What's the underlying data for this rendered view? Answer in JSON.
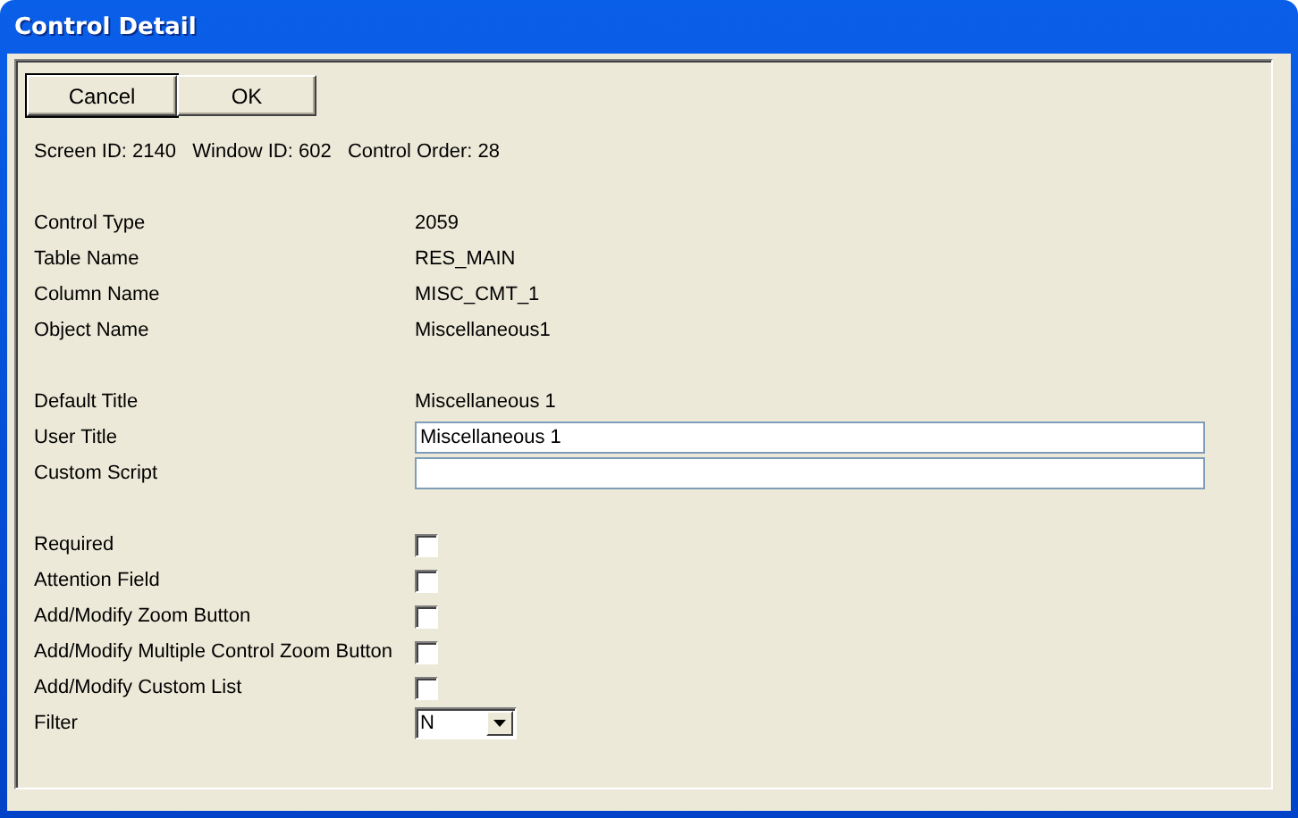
{
  "window": {
    "title": "Control Detail"
  },
  "buttons": [
    {
      "label": "Cancel",
      "default": true
    },
    {
      "label": "OK",
      "default": false
    }
  ],
  "info": "Screen ID: 2140   Window ID: 602   Control Order: 28",
  "groups": [
    [
      {
        "kind": "text",
        "label": "Control Type",
        "value": "2059"
      },
      {
        "kind": "text",
        "label": "Table Name",
        "value": "RES_MAIN"
      },
      {
        "kind": "text",
        "label": "Column Name",
        "value": "MISC_CMT_1"
      },
      {
        "kind": "text",
        "label": "Object Name",
        "value": "Miscellaneous1"
      }
    ],
    [
      {
        "kind": "text",
        "label": "Default Title",
        "value": "Miscellaneous 1"
      },
      {
        "kind": "input",
        "label": "User Title",
        "value": "Miscellaneous 1"
      },
      {
        "kind": "input",
        "label": "Custom Script"
      }
    ],
    [
      {
        "kind": "checkbox",
        "label": "Required",
        "checked": false
      },
      {
        "kind": "checkbox",
        "label": "Attention Field",
        "checked": false
      },
      {
        "kind": "checkbox",
        "label": "Add/Modify Zoom Button",
        "checked": false
      },
      {
        "kind": "checkbox",
        "label": "Add/Modify Multiple Control Zoom Button",
        "checked": false
      },
      {
        "kind": "checkbox",
        "label": "Add/Modify Custom List",
        "checked": false
      },
      {
        "kind": "select",
        "label": "Filter",
        "value": "N"
      }
    ]
  ]
}
